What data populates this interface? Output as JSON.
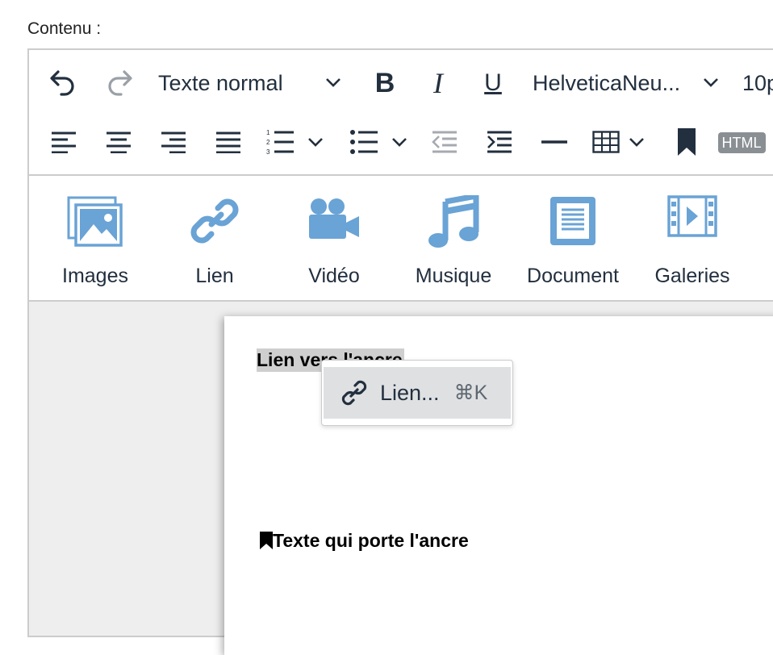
{
  "field": {
    "label": "Contenu :"
  },
  "toolbar": {
    "block_format": "Texte normal",
    "font_family": "HelveticaNeu...",
    "font_size": "10p",
    "html_badge": "HTML",
    "icons": [
      "undo-icon",
      "redo-icon",
      "bold-icon",
      "italic-icon",
      "underline-icon",
      "align-left-icon",
      "align-center-icon",
      "align-right-icon",
      "align-justify-icon",
      "numbered-list-icon",
      "bullet-list-icon",
      "outdent-icon",
      "indent-icon",
      "horizontal-rule-icon",
      "table-icon",
      "bookmark-icon"
    ]
  },
  "media": {
    "items": [
      {
        "label": "Images",
        "icon": "images-icon"
      },
      {
        "label": "Lien",
        "icon": "link-icon"
      },
      {
        "label": "Vidéo",
        "icon": "video-camera-icon"
      },
      {
        "label": "Musique",
        "icon": "music-note-icon"
      },
      {
        "label": "Document",
        "icon": "document-icon"
      },
      {
        "label": "Galeries",
        "icon": "film-strip-icon"
      }
    ],
    "accent": "#6aa3d5"
  },
  "document": {
    "line1": "Lien vers l'ancre",
    "line2": "Texte qui porte l'ancre"
  },
  "context_menu": {
    "item_label": "Lien...",
    "shortcut": "⌘K"
  }
}
